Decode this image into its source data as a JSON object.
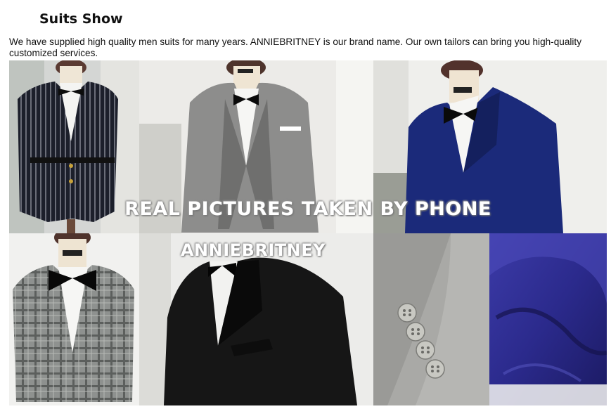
{
  "section": {
    "title": "Suits Show",
    "intro": "We have supplied high quality men suits for many years. ANNIEBRITNEY is our brand name. Our own tailors can bring you high-quality customized services."
  },
  "collage": {
    "overlay_line1": "REAL PICTURES TAKEN BY PHONE",
    "overlay_line2": "ANNIEBRITNEY",
    "photos": [
      {
        "name": "black-pinstripe-suit-photo",
        "subject": "black pinstripe belted suit on mannequin"
      },
      {
        "name": "grey-three-piece-suit-photo",
        "subject": "grey three-piece suit with bow tie"
      },
      {
        "name": "navy-blue-suit-photo",
        "subject": "navy blue double breasted suit with bow tie"
      },
      {
        "name": "grey-plaid-suit-photo",
        "subject": "grey plaid check suit with bow tie"
      },
      {
        "name": "black-suit-photo",
        "subject": "black suit with bow tie"
      },
      {
        "name": "sleeve-buttons-photo",
        "subject": "grey sleeve with four buttons close-up"
      },
      {
        "name": "blue-lining-photo",
        "subject": "purple-blue satin lining close-up"
      }
    ]
  }
}
